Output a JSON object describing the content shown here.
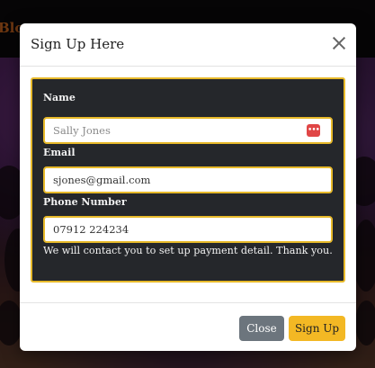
{
  "background": {
    "nav_link": "Blog"
  },
  "modal": {
    "title": "Sign Up Here",
    "form": {
      "name_label": "Name",
      "name_placeholder": "Sally Jones",
      "email_label": "Email",
      "email_value": "sjones@gmail.com",
      "phone_label": "Phone Number",
      "phone_value": "07912 224234",
      "note": "We will contact you to set up payment detail. Thank you."
    },
    "footer": {
      "close_label": "Close",
      "signup_label": "Sign Up"
    }
  },
  "icons": {
    "close": "close-icon",
    "password_manager": "password-manager-icon"
  },
  "colors": {
    "accent": "#e7b92a",
    "signup_button": "#f3b824",
    "close_button": "#6c757d",
    "form_panel": "#25272b"
  }
}
